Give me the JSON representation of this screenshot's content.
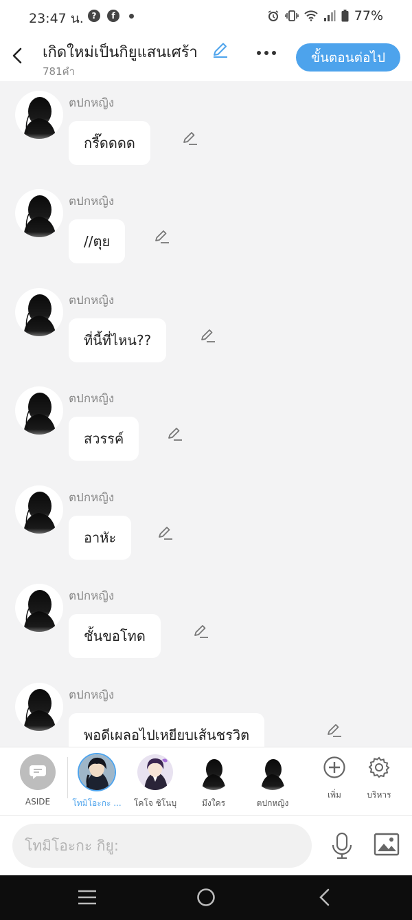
{
  "status_bar": {
    "time": "23:47 น.",
    "battery": "77%",
    "left_icons": [
      "help-circle-icon",
      "facebook-icon",
      "dot-icon"
    ],
    "right_icons": [
      "alarm-icon",
      "vibrate-icon",
      "wifi-icon",
      "signal-icon",
      "battery-icon"
    ]
  },
  "header": {
    "title": "เกิดใหม่เป็นกิยูแสนเศร้า",
    "word_count": "781คำ",
    "next_button": "ขั้นตอนต่อไป",
    "accent_color": "#4da3ec"
  },
  "messages": [
    {
      "sender": "ตปกหญิง",
      "text": "กรี๊ดดดด"
    },
    {
      "sender": "ตปกหญิง",
      "text": "//ตุย"
    },
    {
      "sender": "ตปกหญิง",
      "text": "ที่นี้ที่ไหน??"
    },
    {
      "sender": "ตปกหญิง",
      "text": "สวรรค์"
    },
    {
      "sender": "ตปกหญิง",
      "text": "อาหัะ"
    },
    {
      "sender": "ตปกหญิง",
      "text": "ชั้นขอโทด"
    },
    {
      "sender": "ตปกหญิง",
      "text": "พอดีเผลอไปเหยียบเส้นชรวิต"
    }
  ],
  "characters": [
    {
      "label": "ASIDE"
    },
    {
      "label": "โทมิโอะกะ ...",
      "selected": true
    },
    {
      "label": "โคโจ ชิโนบุ"
    },
    {
      "label": "มึงใคร"
    },
    {
      "label": "ตปกหญิง"
    }
  ],
  "tools": [
    {
      "label": "เพิ่ม",
      "icon": "plus-circle-icon"
    },
    {
      "label": "บริหาร",
      "icon": "gear-icon"
    }
  ],
  "input": {
    "placeholder": "โทมิโอะกะ กิยู:"
  }
}
